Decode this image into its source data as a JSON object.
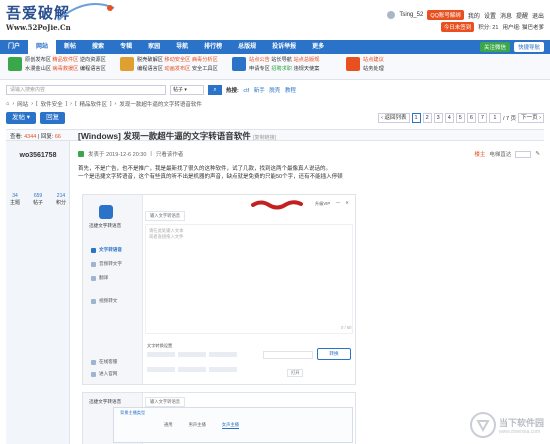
{
  "site": {
    "logo_main": "吾爱破解",
    "logo_sub": "Www.52PoJie.Cn"
  },
  "userbar": {
    "username": "Tsing_52",
    "qq_label": "QQ账号解绑",
    "links": [
      "我的",
      "设置",
      "消息",
      "提醒",
      "退出"
    ],
    "signin_label": "今日未签到",
    "score_label": "积分: 21",
    "group_label": "用户组: 猫巴老爹"
  },
  "nav": {
    "items": [
      "门户",
      "网站",
      "新帖",
      "搜索",
      "专辑",
      "家园",
      "导航",
      "排行榜",
      "总版规",
      "投诉举报",
      "更多"
    ],
    "active_index": 1,
    "follow_label": "关注微信",
    "quick_nav_label": "快捷导航"
  },
  "quick": {
    "groups": [
      {
        "lines": [
          "原创发布区",
          "水漫金山区"
        ],
        "more": [
          "精品软件区",
          "病毒救援区",
          "逆向资源区",
          "编程语言区"
        ]
      },
      {
        "lines": [
          "脱壳破解区",
          "编程语言区"
        ],
        "more": [
          "移动安全区",
          "病毒分析区",
          "动画发布区",
          "安全工具区"
        ]
      },
      {
        "lines": [
          "站点公告",
          "申请专区"
        ],
        "more": [
          "站长导航",
          "站点总版规",
          "招聘求职",
          "违规天使案"
        ]
      },
      {
        "lines": [
          "站点建议",
          "站务处理"
        ],
        "more": []
      }
    ]
  },
  "search": {
    "placeholder": "请输入搜索内容",
    "scope": "帖子",
    "hot_label": "热搜:",
    "hot_links": [
      "ctf",
      "新手",
      "脱壳",
      "教程"
    ]
  },
  "breadcrumb": [
    "网站",
    "软件安全",
    "精品软件区",
    "发现一款超牛逼的文字转语音软件"
  ],
  "actions": {
    "post_label": "发帖",
    "reply_label": "回复",
    "back_label": "返回列表",
    "pages": [
      "1",
      "2",
      "3",
      "4",
      "5",
      "6",
      "7"
    ],
    "current_page": "1",
    "page_input": "1",
    "page_total": "/ 7 页",
    "next_label": "下一页"
  },
  "thread": {
    "views_label": "查看:",
    "views": "4344",
    "replies_label": "回复:",
    "replies": "66",
    "title": "[Windows] 发现一款超牛逼的文字转语音软件",
    "copy_link": "[复制链接]",
    "author": "wo3561758",
    "author_stats": [
      {
        "value": "34",
        "label": "主题"
      },
      {
        "value": "659",
        "label": "帖子"
      },
      {
        "value": "214",
        "label": "积分"
      }
    ],
    "posted_at": "发表于 2019-12-6 20:30",
    "only_author": "只看该作者",
    "floor_label": "楼主",
    "jump_label": "电梯直达",
    "content_lines": [
      "首先，不是广告，也不是推广，我是最新找了很久的这种软件，试了几款，找到这两个最像真人说话的。",
      "一个是迅捷文字转语音，这个有些真的听不出是机器的声音，缺点就是免费的只能50个字，还有不能插入停顿"
    ]
  },
  "embedded_app": {
    "app_title": "迅捷文字转语音",
    "sidebar": [
      "文字转语音",
      "音频转文字",
      "翻译",
      "视频转文",
      "在线客服",
      "进入官网"
    ],
    "input_tab": "输入文字转语音",
    "placeholder_line1": "请在此处输入文本",
    "placeholder_line2": "或者直接拖入文件",
    "count": "0 / 50",
    "settings_label": "文字转换设置",
    "open_file": "打开",
    "convert_label": "转换",
    "vip_label": "升级VIP",
    "second_title": "迅捷文字转语音",
    "second_tab": "输入文字转语音",
    "dialog_title": "背景主播类型",
    "dialog_tabs": [
      "通用",
      "男声主播",
      "女声主播"
    ]
  },
  "watermark": {
    "title": "当下软件园",
    "subtitle": "www.downxia.com"
  },
  "colors": {
    "brand_blue": "#2a73c8",
    "accent_orange": "#e8501f",
    "green": "#3aa84a"
  }
}
